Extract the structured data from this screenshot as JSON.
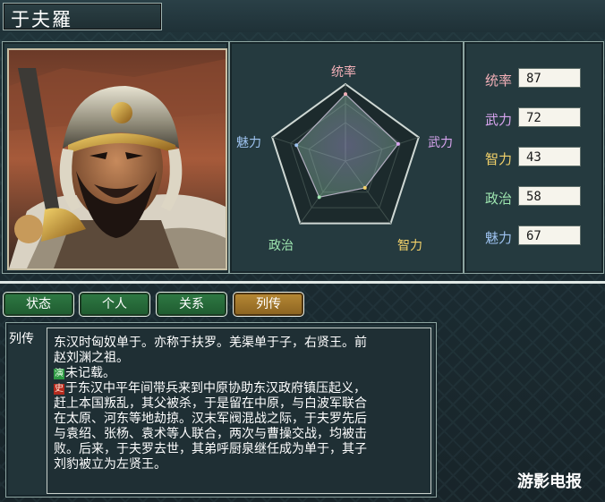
{
  "window": {
    "title": "于夫羅"
  },
  "portrait": {
    "alt": ""
  },
  "radar": {
    "axes": [
      {
        "key": "leadership",
        "label": "统率",
        "value": 87,
        "color": "#f3b0b8"
      },
      {
        "key": "war",
        "label": "武力",
        "value": 72,
        "color": "#d8a4ef"
      },
      {
        "key": "intelligence",
        "label": "智力",
        "value": 43,
        "color": "#f3d26a"
      },
      {
        "key": "politics",
        "label": "政治",
        "value": 58,
        "color": "#9ee6b0"
      },
      {
        "key": "charm",
        "label": "魅力",
        "value": 67,
        "color": "#9ec3f0"
      }
    ],
    "max": 100
  },
  "stats": [
    {
      "label": "统率",
      "value": "87",
      "color": "#f3b0b8"
    },
    {
      "label": "武力",
      "value": "72",
      "color": "#d8a4ef"
    },
    {
      "label": "智力",
      "value": "43",
      "color": "#f3d26a"
    },
    {
      "label": "政治",
      "value": "58",
      "color": "#9ee6b0"
    },
    {
      "label": "魅力",
      "value": "67",
      "color": "#9ec3f0"
    }
  ],
  "tabs": [
    {
      "label": "状态",
      "active": false
    },
    {
      "label": "个人",
      "active": false
    },
    {
      "label": "关系",
      "active": false
    },
    {
      "label": "列传",
      "active": true
    }
  ],
  "biography": {
    "label": "列传",
    "lines": [
      {
        "text": "东汉时匈奴单于。亦称于扶罗。羌渠单于子，右贤王。前"
      },
      {
        "text": "赵刘渊之祖。"
      },
      {
        "icon": "演",
        "icon_color": "#2f9a45",
        "text": "未记载。"
      },
      {
        "icon": "史",
        "icon_color": "#b32a1e",
        "text": "于东汉中平年间带兵来到中原协助东汉政府镇压起义，"
      },
      {
        "text": "赶上本国叛乱，其父被杀，于是留在中原，与白波军联合"
      },
      {
        "text": "在太原、河东等地劫掠。汉末军阀混战之际，于夫罗先后"
      },
      {
        "text": "与袁绍、张杨、袁术等人联合，两次与曹操交战，均被击"
      },
      {
        "text": "败。后来，于夫罗去世，其弟呼厨泉继任成为单于，其子"
      },
      {
        "text": "刘豹被立为左贤王。"
      }
    ]
  },
  "watermark": "游影电报"
}
